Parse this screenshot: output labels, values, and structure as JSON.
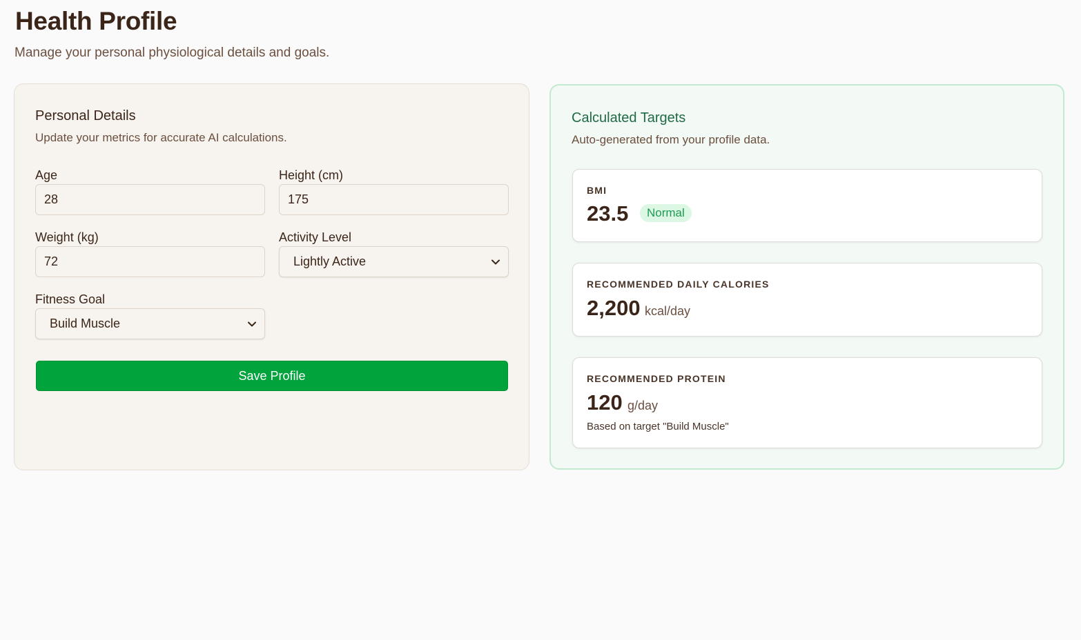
{
  "header": {
    "title": "Health Profile",
    "subtitle": "Manage your personal physiological details and goals."
  },
  "personal_details": {
    "title": "Personal Details",
    "description": "Update your metrics for accurate AI calculations.",
    "fields": {
      "age": {
        "label": "Age",
        "value": "28"
      },
      "height": {
        "label": "Height (cm)",
        "value": "175"
      },
      "weight": {
        "label": "Weight (kg)",
        "value": "72"
      },
      "activity_level": {
        "label": "Activity Level",
        "value": "Lightly Active"
      },
      "fitness_goal": {
        "label": "Fitness Goal",
        "value": "Build Muscle"
      }
    },
    "save_label": "Save Profile"
  },
  "calculated_targets": {
    "title": "Calculated Targets",
    "description": "Auto-generated from your profile data.",
    "bmi": {
      "label": "BMI",
      "value": "23.5",
      "status": "Normal"
    },
    "calories": {
      "label": "RECOMMENDED DAILY CALORIES",
      "value": "2,200",
      "unit": "kcal/day"
    },
    "protein": {
      "label": "RECOMMENDED PROTEIN",
      "value": "120",
      "unit": "g/day",
      "note": "Based on target \"Build Muscle\""
    }
  },
  "colors": {
    "accent": "#00a33c",
    "heading": "#3b2418",
    "targets_title": "#1f6b45",
    "badge_bg": "#dcf7e4",
    "badge_text": "#1e9a52"
  },
  "icons": {
    "select_arrow": "chevron-down-icon"
  }
}
